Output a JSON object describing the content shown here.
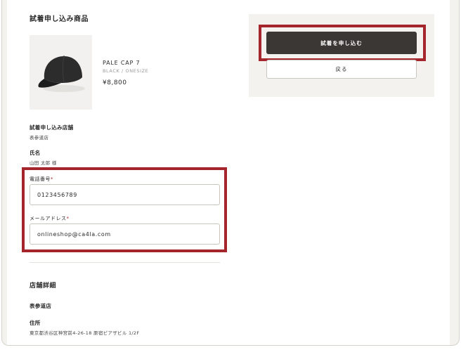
{
  "section_title": "試着申し込み商品",
  "product": {
    "name": "PALE CAP 7",
    "variant": "BLACK / ONESIZE",
    "price": "¥8,800"
  },
  "store_label": "試着申し込み店舗",
  "store_value": "表参道店",
  "name_label": "氏名",
  "name_value": "山田 太郎 様",
  "phone": {
    "label": "電話番号",
    "required_mark": "*",
    "value": "0123456789"
  },
  "email": {
    "label": "メールアドレス",
    "required_mark": "*",
    "value": "onlineshop@ca4la.com"
  },
  "store_detail": {
    "title": "店舗詳細",
    "store_name": "表参道店",
    "address_label": "住所",
    "address_value": "東京都渋谷区神宮前4-26-18 原宿ピアザビル 1/2F"
  },
  "actions": {
    "submit_label": "試着を申し込む",
    "back_label": "戻る"
  },
  "colors": {
    "highlight": "#a4262c",
    "primary_button": "#3b3735",
    "panel_bg": "#f3f2ee"
  },
  "icons": {
    "product_image": "black-cap-image"
  }
}
